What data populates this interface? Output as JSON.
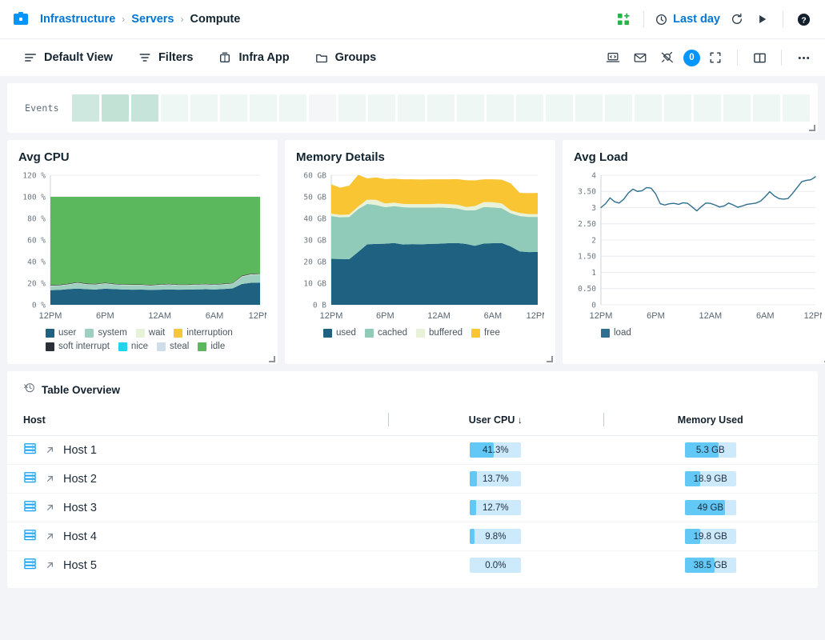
{
  "header": {
    "brand_icon": "infrastructure-logo-icon",
    "breadcrumb": [
      {
        "label": "Infrastructure",
        "current": false
      },
      {
        "label": "Servers",
        "current": false
      },
      {
        "label": "Compute",
        "current": true
      }
    ],
    "separator": "›",
    "apps_icon": "add-app-icon",
    "time_range": "Last day",
    "clock_icon": "clock-icon",
    "refresh_icon": "refresh-icon",
    "play_icon": "play-icon",
    "help_icon": "help-circle-icon"
  },
  "actionbar": {
    "items": [
      {
        "label": "Default View",
        "icon": "list-view-icon"
      },
      {
        "label": "Filters",
        "icon": "filter-icon"
      },
      {
        "label": "Infra App",
        "icon": "app-icon"
      },
      {
        "label": "Groups",
        "icon": "folder-icon"
      }
    ],
    "right_icons": [
      "laptop-code-icon",
      "envelope-icon",
      "plug-disconnected-icon"
    ],
    "notification_count": "0",
    "fullscreen_icon": "fullscreen-icon",
    "split-view_icon": "split-view-icon",
    "more_icon": "more-horizontal-icon"
  },
  "events": {
    "label": "Events",
    "cells": [
      0.55,
      0.7,
      0.65,
      0.18,
      0.18,
      0.18,
      0.18,
      0.18,
      0.04,
      0.18,
      0.18,
      0.18,
      0.18,
      0.18,
      0.18,
      0.18,
      0.18,
      0.18,
      0.18,
      0.18,
      0.18,
      0.18,
      0.18,
      0.18,
      0.18
    ],
    "base_color": "#a8d5c4"
  },
  "charts": [
    {
      "id": "avg-cpu",
      "title": "Avg CPU"
    },
    {
      "id": "memory-details",
      "title": "Memory Details"
    },
    {
      "id": "avg-load",
      "title": "Avg Load"
    }
  ],
  "chart_data": [
    {
      "type": "area",
      "id": "avg-cpu",
      "title": "Avg CPU",
      "stacked": true,
      "grid": true,
      "legend_position": "bottom",
      "xlabel": "",
      "ylabel": "",
      "ylim": [
        0,
        120
      ],
      "yticks": [
        0,
        20,
        40,
        60,
        80,
        100,
        120
      ],
      "ytick_labels": [
        "0 %",
        "20 %",
        "40 %",
        "60 %",
        "80 %",
        "100 %",
        "120 %"
      ],
      "x": [
        0,
        1,
        2,
        3,
        4,
        5,
        6,
        7,
        8,
        9,
        10,
        11,
        12,
        13,
        14,
        15,
        16,
        17,
        18,
        19,
        20,
        21,
        22,
        23
      ],
      "xtick_labels": [
        "12PM",
        "6PM",
        "12AM",
        "6AM",
        "12PM"
      ],
      "xtick_positions": [
        0,
        6,
        12,
        18,
        23
      ],
      "series": [
        {
          "name": "user",
          "color": "#1f6181",
          "values": [
            13.5,
            13.8,
            14.5,
            15.0,
            14.4,
            14.2,
            14.9,
            14.5,
            14.2,
            14.0,
            14.1,
            13.8,
            14.0,
            14.2,
            14.0,
            14.1,
            14.3,
            14.4,
            14.2,
            14.6,
            15.2,
            19.3,
            20.4,
            20.6
          ]
        },
        {
          "name": "system",
          "color": "#9fcfc0",
          "values": [
            4.0,
            3.9,
            4.2,
            5.0,
            4.3,
            4.3,
            4.7,
            4.1,
            4.0,
            4.0,
            3.9,
            3.8,
            4.1,
            4.4,
            3.9,
            3.8,
            4.0,
            4.2,
            4.0,
            4.1,
            4.2,
            6.6,
            7.3,
            7.4
          ]
        },
        {
          "name": "wait",
          "color": "#e8f2d9",
          "values": [
            0.4,
            0.4,
            0.4,
            0.5,
            0.4,
            0.4,
            0.4,
            0.4,
            0.4,
            0.4,
            0.4,
            0.4,
            0.4,
            0.4,
            0.4,
            0.4,
            0.4,
            0.4,
            0.4,
            0.4,
            0.4,
            0.5,
            0.5,
            0.5
          ]
        },
        {
          "name": "interruption",
          "color": "#f6c63c",
          "values": [
            0,
            0,
            0,
            0,
            0,
            0,
            0,
            0,
            0,
            0,
            0,
            0,
            0,
            0,
            0,
            0,
            0,
            0,
            0,
            0,
            0,
            0,
            0,
            0
          ]
        },
        {
          "name": "soft interrupt",
          "color": "#2b2f38",
          "values": [
            0.5,
            0.5,
            0.5,
            0.5,
            0.5,
            0.5,
            0.5,
            0.5,
            0.5,
            0.5,
            0.5,
            0.5,
            0.5,
            0.5,
            0.5,
            0.5,
            0.5,
            0.5,
            0.5,
            0.5,
            0.5,
            0.6,
            0.6,
            0.6
          ]
        },
        {
          "name": "nice",
          "color": "#22d3ee",
          "values": [
            0,
            0,
            0,
            0,
            0,
            0,
            0,
            0,
            0,
            0,
            0,
            0,
            0,
            0,
            0,
            0,
            0,
            0,
            0,
            0,
            0,
            0,
            0,
            0
          ]
        },
        {
          "name": "steal",
          "color": "#cfdde8",
          "values": [
            0,
            0,
            0,
            0,
            0,
            0,
            0,
            0,
            0,
            0,
            0,
            0,
            0,
            0,
            0,
            0,
            0,
            0,
            0,
            0,
            0,
            0,
            0,
            0
          ]
        },
        {
          "name": "idle",
          "color": "#5cb85c",
          "values": [
            81.6,
            81.4,
            80.4,
            79.0,
            80.4,
            80.6,
            79.5,
            80.5,
            80.9,
            81.1,
            81.1,
            81.5,
            81.0,
            80.5,
            81.2,
            81.2,
            80.8,
            80.5,
            80.9,
            80.4,
            79.7,
            73.0,
            71.2,
            70.9
          ]
        }
      ]
    },
    {
      "type": "area",
      "id": "memory-details",
      "title": "Memory Details",
      "stacked": true,
      "grid": true,
      "legend_position": "bottom",
      "xlabel": "",
      "ylabel": "",
      "ylim": [
        0,
        60
      ],
      "yticks": [
        0,
        10,
        20,
        30,
        40,
        50,
        60
      ],
      "ytick_labels": [
        "0 B",
        "10 GB",
        "20 GB",
        "30 GB",
        "40 GB",
        "50 GB",
        "60 GB"
      ],
      "x": [
        0,
        1,
        2,
        3,
        4,
        5,
        6,
        7,
        8,
        9,
        10,
        11,
        12,
        13,
        14,
        15,
        16,
        17,
        18,
        19,
        20,
        21,
        22,
        23
      ],
      "xtick_labels": [
        "12PM",
        "6PM",
        "12AM",
        "6AM",
        "12PM"
      ],
      "xtick_positions": [
        0,
        6,
        12,
        18,
        23
      ],
      "series": [
        {
          "name": "used",
          "color": "#1f6181",
          "values": [
            21.3,
            21.2,
            21.1,
            24.5,
            28.0,
            28.2,
            28.3,
            28.6,
            27.9,
            28.1,
            28.0,
            28.2,
            28.3,
            28.5,
            28.6,
            28.2,
            27.3,
            28.4,
            28.5,
            28.6,
            27.0,
            24.7,
            24.4,
            24.5
          ]
        },
        {
          "name": "cached",
          "color": "#8fcbb8",
          "values": [
            19.8,
            19.3,
            19.6,
            19.8,
            18.7,
            18.0,
            16.9,
            17.1,
            17.3,
            16.9,
            17.0,
            16.8,
            16.8,
            16.4,
            16.0,
            15.5,
            16.4,
            16.9,
            16.6,
            16.1,
            15.3,
            16.4,
            16.3,
            16.2
          ]
        },
        {
          "name": "buffered",
          "color": "#e8f2d9",
          "values": [
            1.1,
            1.1,
            1.1,
            1.2,
            2.0,
            2.4,
            1.7,
            1.6,
            1.5,
            1.6,
            1.6,
            1.6,
            1.7,
            1.7,
            1.8,
            1.6,
            2.0,
            2.3,
            2.4,
            2.2,
            1.4,
            1.4,
            1.3,
            1.3
          ]
        },
        {
          "name": "free",
          "color": "#f9c533",
          "values": [
            13.6,
            12.6,
            13.4,
            14.7,
            9.8,
            10.4,
            11.3,
            11.1,
            11.4,
            11.5,
            11.4,
            11.5,
            11.3,
            11.5,
            11.8,
            12.4,
            11.9,
            10.5,
            10.6,
            11.0,
            12.5,
            9.3,
            9.7,
            9.8
          ]
        }
      ]
    },
    {
      "type": "line",
      "id": "avg-load",
      "title": "Avg Load",
      "grid": true,
      "legend_position": "bottom",
      "xlabel": "",
      "ylabel": "",
      "ylim": [
        0,
        4
      ],
      "yticks": [
        0,
        0.5,
        1,
        1.5,
        2,
        2.5,
        3,
        3.5,
        4
      ],
      "ytick_labels": [
        "0",
        "0.50",
        "1",
        "1.50",
        "2",
        "2.50",
        "3",
        "3.50",
        "4"
      ],
      "xtick_labels": [
        "12PM",
        "6PM",
        "12AM",
        "6AM",
        "12PM"
      ],
      "xtick_positions": [
        0,
        12,
        24,
        36,
        47
      ],
      "series": [
        {
          "name": "load",
          "color": "#2e6e8e",
          "values": [
            3.0,
            3.12,
            3.3,
            3.18,
            3.14,
            3.26,
            3.45,
            3.57,
            3.5,
            3.52,
            3.62,
            3.6,
            3.42,
            3.12,
            3.08,
            3.12,
            3.13,
            3.1,
            3.15,
            3.13,
            3.02,
            2.9,
            3.03,
            3.14,
            3.13,
            3.08,
            3.02,
            3.05,
            3.14,
            3.08,
            3.01,
            3.05,
            3.1,
            3.12,
            3.14,
            3.2,
            3.34,
            3.49,
            3.36,
            3.28,
            3.26,
            3.28,
            3.44,
            3.62,
            3.8,
            3.84,
            3.86,
            3.95
          ]
        }
      ]
    }
  ],
  "table": {
    "title": "Table Overview",
    "title_icon": "clock-disabled-icon",
    "columns": [
      {
        "key": "host",
        "label": "Host",
        "sorted": false
      },
      {
        "key": "cpu",
        "label": "User CPU",
        "sorted": true,
        "sort_icon": "↓"
      },
      {
        "key": "mem",
        "label": "Memory Used",
        "sorted": false
      }
    ],
    "row_icon": "server-rack-icon",
    "link_icon": "external-link-arrow-icon",
    "rows": [
      {
        "host": "Host 1",
        "cpu": "41.3%",
        "cpu_fill": 0.46,
        "mem": "5.3 GB",
        "mem_fill": 0.66
      },
      {
        "host": "Host 2",
        "cpu": "13.7%",
        "cpu_fill": 0.13,
        "mem": "18.9 GB",
        "mem_fill": 0.3
      },
      {
        "host": "Host 3",
        "cpu": "12.7%",
        "cpu_fill": 0.12,
        "mem": "49 GB",
        "mem_fill": 0.78
      },
      {
        "host": "Host 4",
        "cpu": "9.8%",
        "cpu_fill": 0.09,
        "mem": "19.8 GB",
        "mem_fill": 0.3
      },
      {
        "host": "Host 5",
        "cpu": "0.0%",
        "cpu_fill": 0.0,
        "mem": "38.5 GB",
        "mem_fill": 0.58
      }
    ],
    "bar_track_color": "#cdeafc",
    "bar_fill_color": "#62c8f5"
  }
}
